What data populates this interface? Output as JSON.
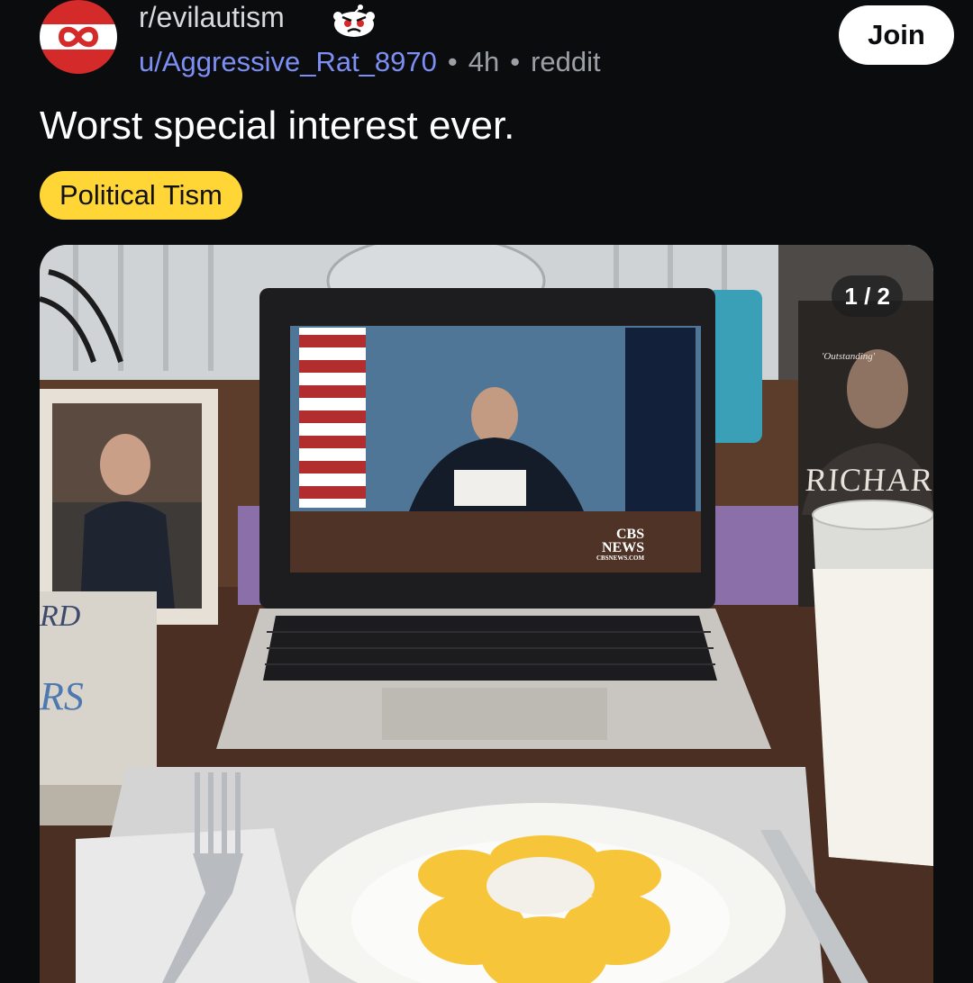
{
  "post": {
    "subreddit": "r/evilautism",
    "author": "u/Aggressive_Rat_8970",
    "age": "4h",
    "source": "reddit",
    "join_label": "Join",
    "title": "Worst special interest ever.",
    "flair": "Political Tism",
    "flair_color": "#ffd635"
  },
  "media": {
    "counter": "1 / 2",
    "cbs_logo_line1": "CBS",
    "cbs_logo_line2": "NEWS",
    "cbs_logo_line3": "CBSNEWS.COM",
    "book_right_spine": "RICHAR",
    "book_right_tagline": "'Outstanding'",
    "book_left_text_1": "RD",
    "book_left_text_2": "RS"
  },
  "icons": {
    "subreddit_avatar": "infinity-icon",
    "subreddit_badge": "angry-snoo-icon"
  },
  "colors": {
    "background": "#0b0c0e",
    "username": "#7d8ff5",
    "meta_text": "#9aa0a6"
  }
}
